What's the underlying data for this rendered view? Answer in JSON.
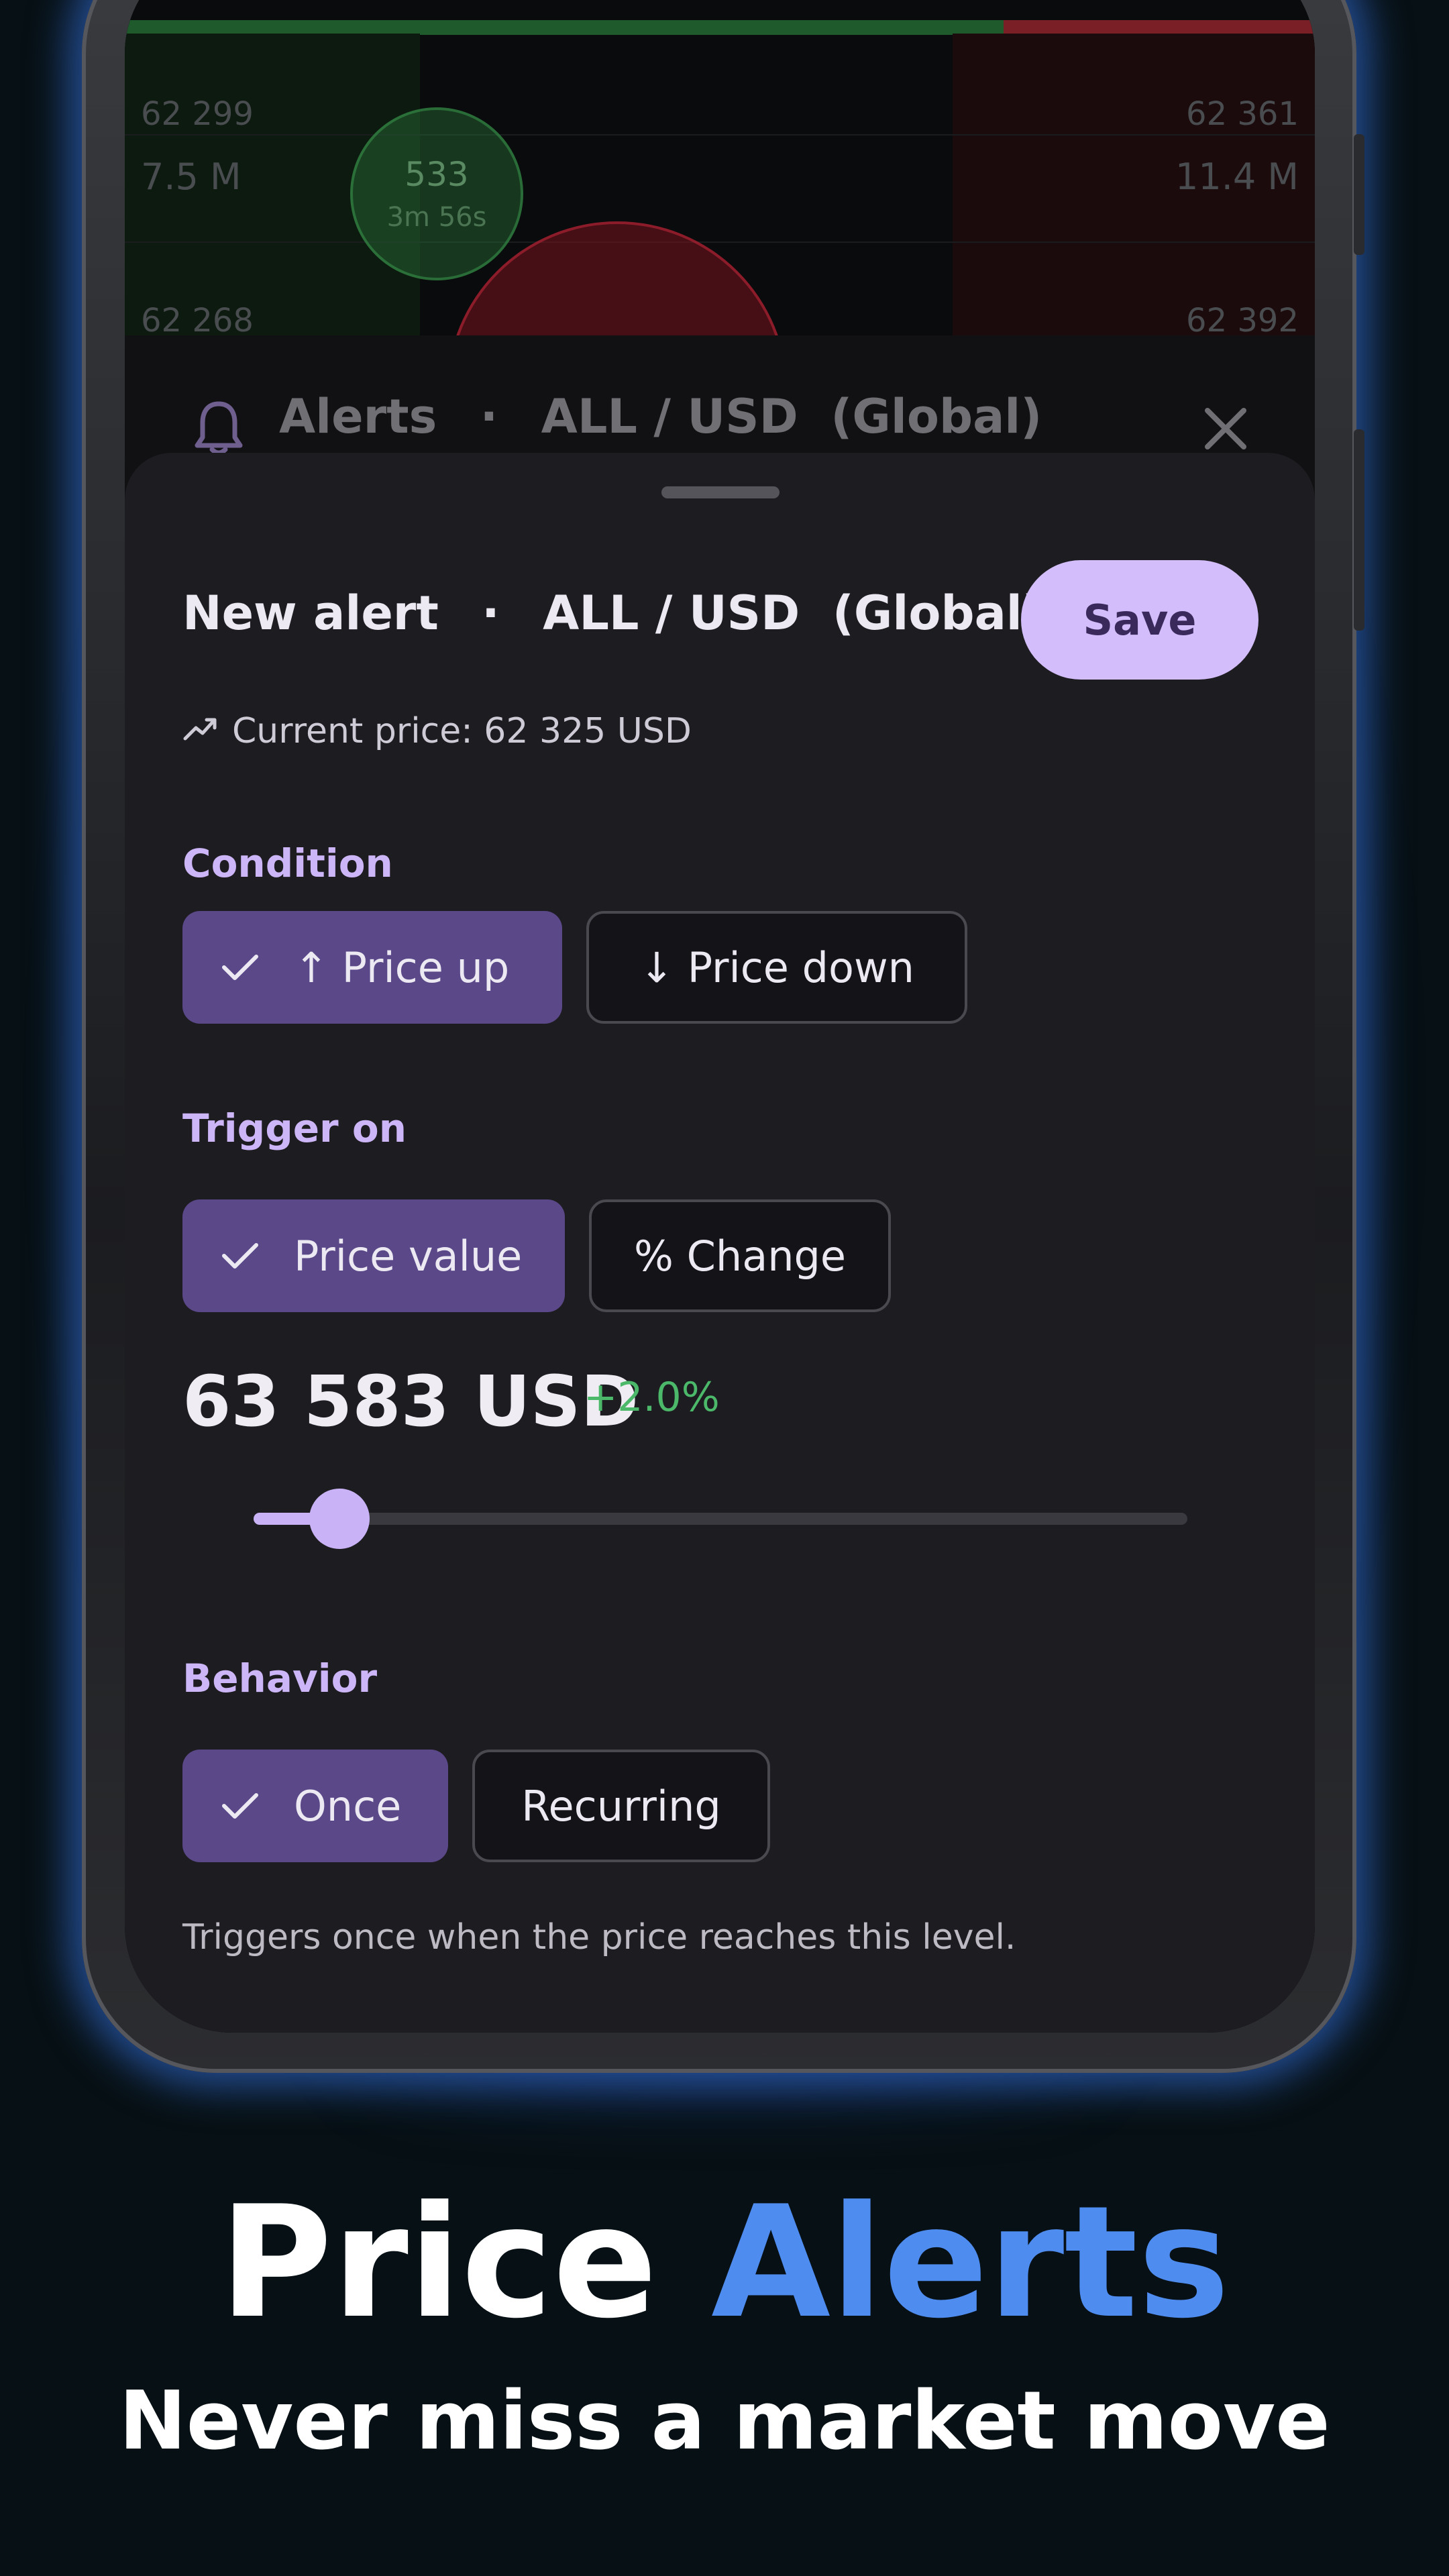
{
  "chart": {
    "left_price_1": "62 299",
    "left_volume_1": "7.5 M",
    "left_price_2": "62 268",
    "right_price_1": "62 361",
    "right_volume_1": "11.4 M",
    "right_price_2": "62 392",
    "bubble_count": "533",
    "bubble_time": "3m 56s"
  },
  "alerts_header": {
    "title": "Alerts",
    "separator": "·",
    "pair": "ALL / USD  (Global)"
  },
  "sheet": {
    "title_prefix": "New alert",
    "separator": "·",
    "pair": "ALL / USD  (Global)",
    "save_label": "Save",
    "current_price": "Current price: 62 325 USD"
  },
  "condition": {
    "label": "Condition",
    "options": [
      "↑ Price up",
      "↓ Price down"
    ],
    "selected": 0
  },
  "trigger": {
    "label": "Trigger on",
    "options": [
      "Price value",
      "% Change"
    ],
    "selected": 0
  },
  "target": {
    "value": "63 583 USD",
    "change": "+2.0%",
    "slider_fraction": 0.06
  },
  "behavior": {
    "label": "Behavior",
    "options": [
      "Once",
      "Recurring"
    ],
    "selected": 0,
    "helper": "Triggers once when the price reaches this level."
  },
  "marketing": {
    "headline_plain": "Price",
    "headline_accent": "Alerts",
    "subline": "Never miss a market move"
  },
  "colors": {
    "accent_purple": "#d3bdfa",
    "selected_chip": "#5a4889",
    "positive_green": "#4bb86a",
    "headline_accent": "#4f8cf0"
  }
}
